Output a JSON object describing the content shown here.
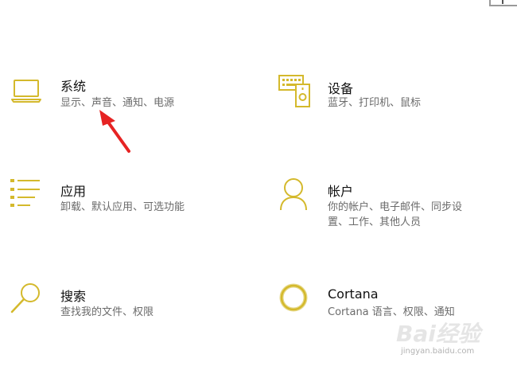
{
  "accent_color": "#d4b92c",
  "tiles": [
    {
      "icon": "laptop-icon",
      "title": "系统",
      "desc": [
        "显示、声音、通知、电源"
      ]
    },
    {
      "icon": "devices-icon",
      "title": "设备",
      "desc": [
        "蓝牙、打印机、鼠标"
      ]
    },
    {
      "icon": "apps-list-icon",
      "title": "应用",
      "desc": [
        "卸载、默认应用、可选功能"
      ]
    },
    {
      "icon": "person-icon",
      "title": "帐户",
      "desc": [
        "你的帐户、电子邮件、同步设",
        "置、工作、其他人员"
      ]
    },
    {
      "icon": "search-icon",
      "title": "搜索",
      "desc": [
        "查找我的文件、权限"
      ]
    },
    {
      "icon": "cortana-icon",
      "title": "Cortana",
      "desc": [
        "Cortana 语言、权限、通知"
      ]
    }
  ],
  "watermark": {
    "logo": "Bai经验",
    "url": "jingyan.baidu.com"
  }
}
